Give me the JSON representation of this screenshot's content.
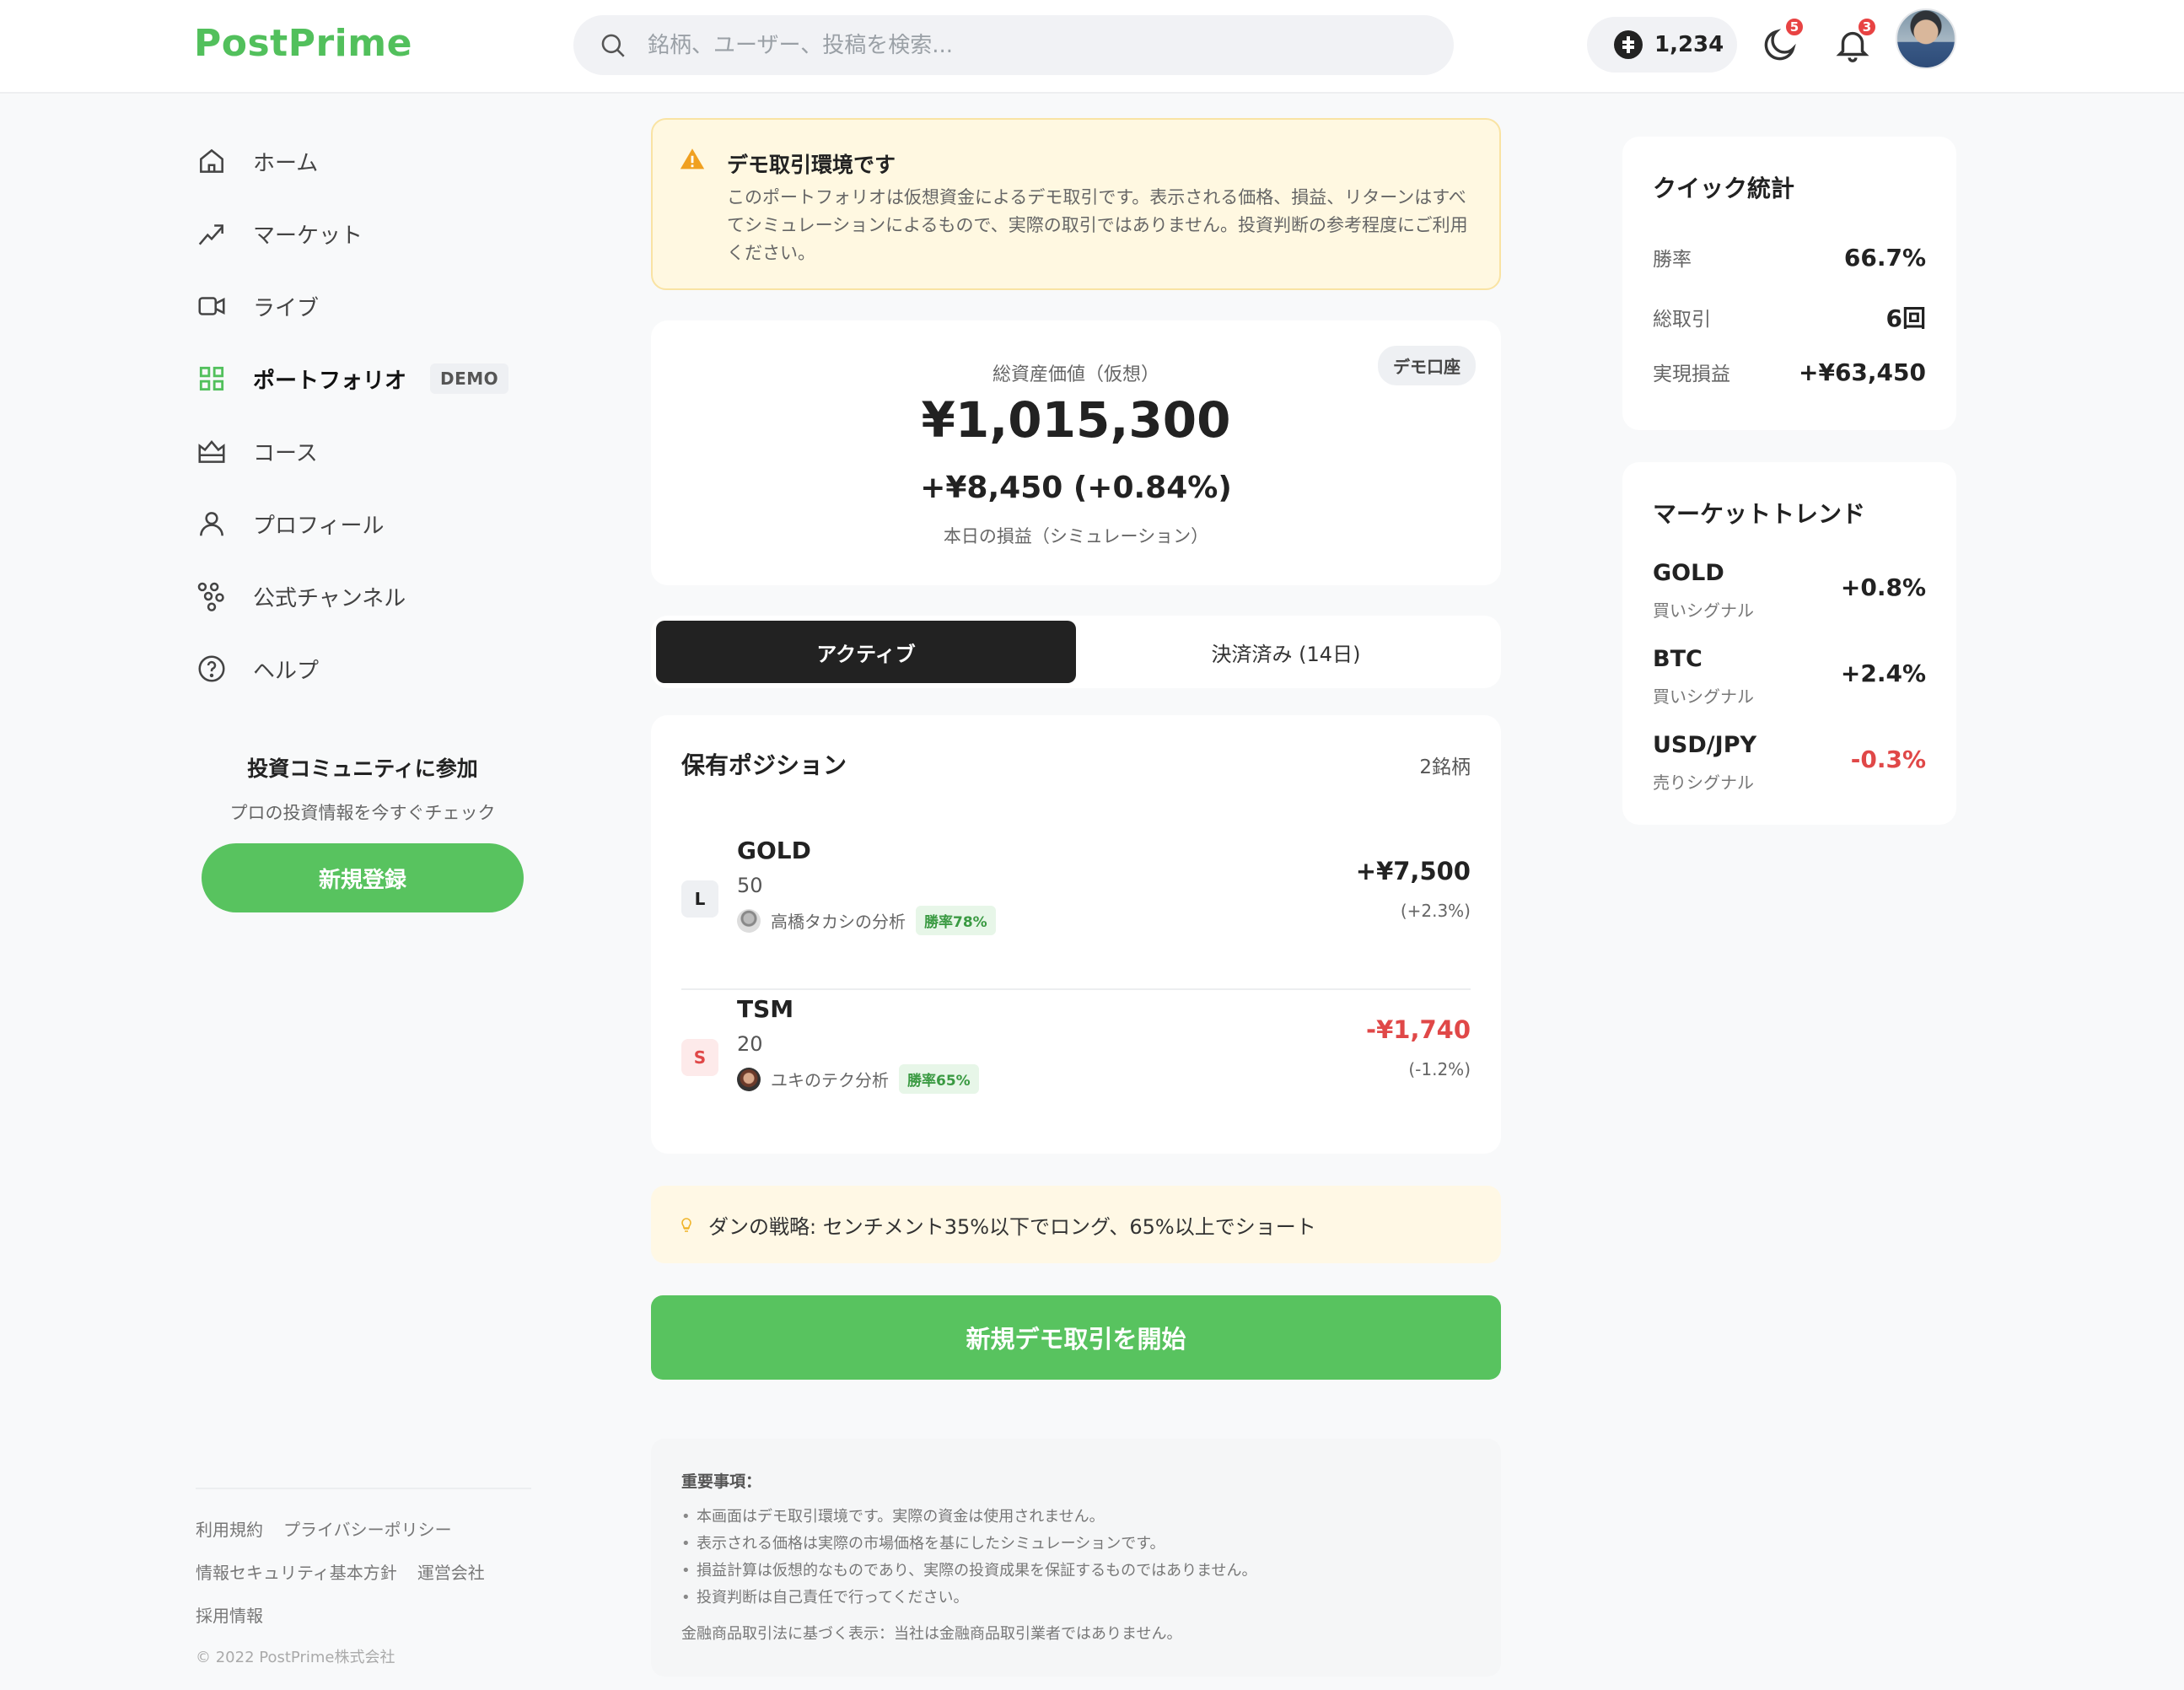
{
  "app": {
    "logo": "PostPrime"
  },
  "search": {
    "placeholder": "銘柄、ユーザー、投稿を検索..."
  },
  "header": {
    "points": "1,234",
    "coin_badge": "5",
    "notification_badge": "3"
  },
  "sidebar": {
    "items": [
      {
        "label": "ホーム",
        "icon": "home-icon"
      },
      {
        "label": "マーケット",
        "icon": "trend-up-icon"
      },
      {
        "label": "ライブ",
        "icon": "video-icon"
      },
      {
        "label": "ポートフォリオ",
        "icon": "grid-icon",
        "tag": "DEMO"
      },
      {
        "label": "コース",
        "icon": "course-icon"
      },
      {
        "label": "プロフィール",
        "icon": "user-icon"
      },
      {
        "label": "公式チャンネル",
        "icon": "channel-icon"
      },
      {
        "label": "ヘルプ",
        "icon": "help-icon"
      }
    ],
    "community": {
      "title": "投資コミュニティに参加",
      "subtitle": "プロの投資情報を今すぐチェック",
      "button": "新規登録"
    },
    "footer": {
      "links": [
        "利用規約",
        "プライバシーポリシー",
        "情報セキュリティ基本方針",
        "運営会社",
        "採用情報"
      ],
      "copyright": "© 2022 PostPrime株式会社"
    }
  },
  "warning": {
    "title": "デモ取引環境です",
    "body": "このポートフォリオは仮想資金によるデモ取引です。表示される価格、損益、リターンはすべてシミュレーションによるもので、実際の取引ではありません。投資判断の参考程度にご利用ください。"
  },
  "portfolio": {
    "account_tag": "デモ口座",
    "total_label": "総資産価値（仮想）",
    "total_value": "¥1,015,300",
    "day_change": "+¥8,450 (+0.84%)",
    "day_change_label": "本日の損益（シミュレーション）"
  },
  "tabs": {
    "active": "アクティブ",
    "closed": "決済済み (14日)"
  },
  "positions": {
    "title": "保有ポジション",
    "count": "2銘柄",
    "rows": [
      {
        "side": "L",
        "symbol": "GOLD",
        "qty": "50",
        "source": "高橋タカシの分析",
        "winrate": "勝率78%",
        "pnl": "+¥7,500",
        "pct": "(+2.3%)"
      },
      {
        "side": "S",
        "symbol": "TSM",
        "qty": "20",
        "source": "ユキのテク分析",
        "winrate": "勝率65%",
        "pnl": "-¥1,740",
        "pct": "(-1.2%)"
      }
    ]
  },
  "tip": {
    "text": "ダンの戦略: センチメント35%以下でロング、65%以上でショート"
  },
  "start_button": "新規デモ取引を開始",
  "notes": {
    "title": "重要事項：",
    "items": [
      "本画面はデモ取引環境です。実際の資金は使用されません。",
      "表示される価格は実際の市場価格を基にしたシミュレーションです。",
      "損益計算は仮想的なものであり、実際の投資成果を保証するものではありません。",
      "投資判断は自己責任で行ってください。"
    ],
    "legal": "金融商品取引法に基づく表示：当社は金融商品取引業者ではありません。"
  },
  "quick_stats": {
    "title": "クイック統計",
    "rows": [
      {
        "k": "勝率",
        "v": "66.7%"
      },
      {
        "k": "総取引",
        "v": "6回"
      },
      {
        "k": "実現損益",
        "v": "+¥63,450"
      }
    ]
  },
  "market_trend": {
    "title": "マーケットトレンド",
    "rows": [
      {
        "symbol": "GOLD",
        "signal": "買いシグナル",
        "change": "+0.8%"
      },
      {
        "symbol": "BTC",
        "signal": "買いシグナル",
        "change": "+2.4%"
      },
      {
        "symbol": "USD/JPY",
        "signal": "売りシグナル",
        "change": "-0.3%"
      }
    ]
  },
  "colors": {
    "brand": "#52c05c",
    "positive": "#222222",
    "negative": "#e04848",
    "warning_bg": "#fff8e1"
  }
}
